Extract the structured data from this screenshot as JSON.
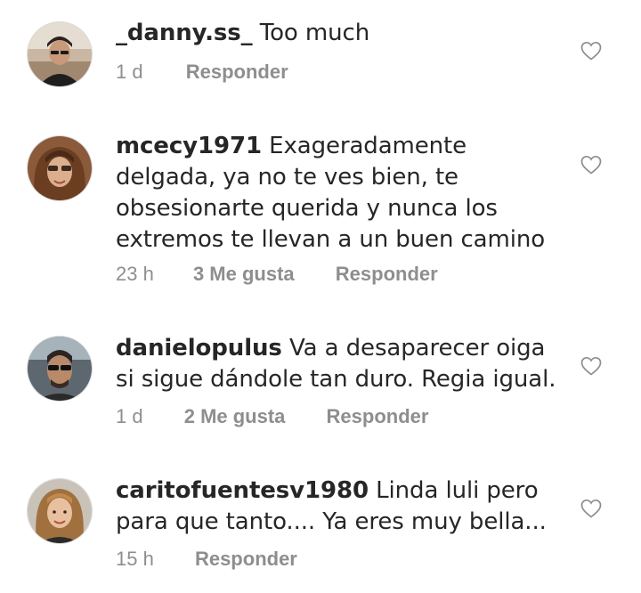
{
  "comments": [
    {
      "username": "_danny.ss_",
      "text": "Too much",
      "time": "1 d",
      "likes": "",
      "reply_label": "Responder"
    },
    {
      "username": "mcecy1971",
      "text": "Exageradamente delgada, ya no te ves bien, te obsesionarte querida y nunca los extremos te llevan a un buen camino",
      "time": "23 h",
      "likes": "3 Me gusta",
      "reply_label": "Responder"
    },
    {
      "username": "danielopulus",
      "text": "Va a desaparecer oiga si sigue dándole tan duro. Regia igual.",
      "time": "1 d",
      "likes": "2 Me gusta",
      "reply_label": "Responder"
    },
    {
      "username": "caritofuentesv1980",
      "text": "Linda luli pero para que tanto.... Ya eres muy bella...",
      "time": "15 h",
      "likes": "",
      "reply_label": "Responder"
    }
  ],
  "icons": {
    "like": "heart-outline-icon"
  },
  "colors": {
    "text": "#262626",
    "meta": "#8e8e8e",
    "heart": "#8e8e8e"
  }
}
